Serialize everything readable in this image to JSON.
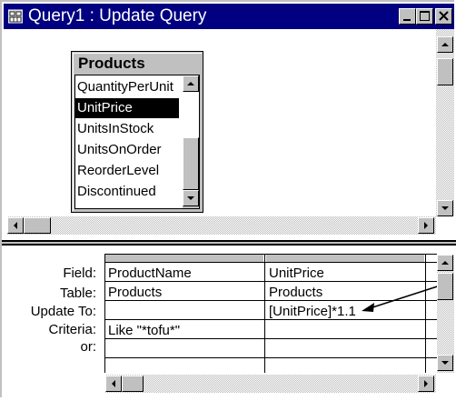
{
  "window": {
    "title": "Query1 : Update Query",
    "title_icon": "query-window-icon",
    "buttons": [
      "minimize-icon",
      "maximize-icon",
      "close-icon"
    ],
    "colors": {
      "titlebar": "#000080",
      "face": "#c0c0c0",
      "selection": "#000000"
    }
  },
  "table": {
    "name": "Products",
    "fields": [
      {
        "label": "QuantityPerUnit",
        "selected": false
      },
      {
        "label": "UnitPrice",
        "selected": true
      },
      {
        "label": "UnitsInStock",
        "selected": false
      },
      {
        "label": "UnitsOnOrder",
        "selected": false
      },
      {
        "label": "ReorderLevel",
        "selected": false
      },
      {
        "label": "Discontinued",
        "selected": false
      }
    ]
  },
  "grid": {
    "row_labels": [
      "Field:",
      "Table:",
      "Update To:",
      "Criteria:",
      "or:"
    ],
    "columns": [
      {
        "field": "ProductName",
        "table": "Products",
        "update_to": "",
        "criteria": "Like \"*tofu*\"",
        "or": ""
      },
      {
        "field": "UnitPrice",
        "table": "Products",
        "update_to": "[UnitPrice]*1.1",
        "criteria": "",
        "or": ""
      }
    ]
  }
}
